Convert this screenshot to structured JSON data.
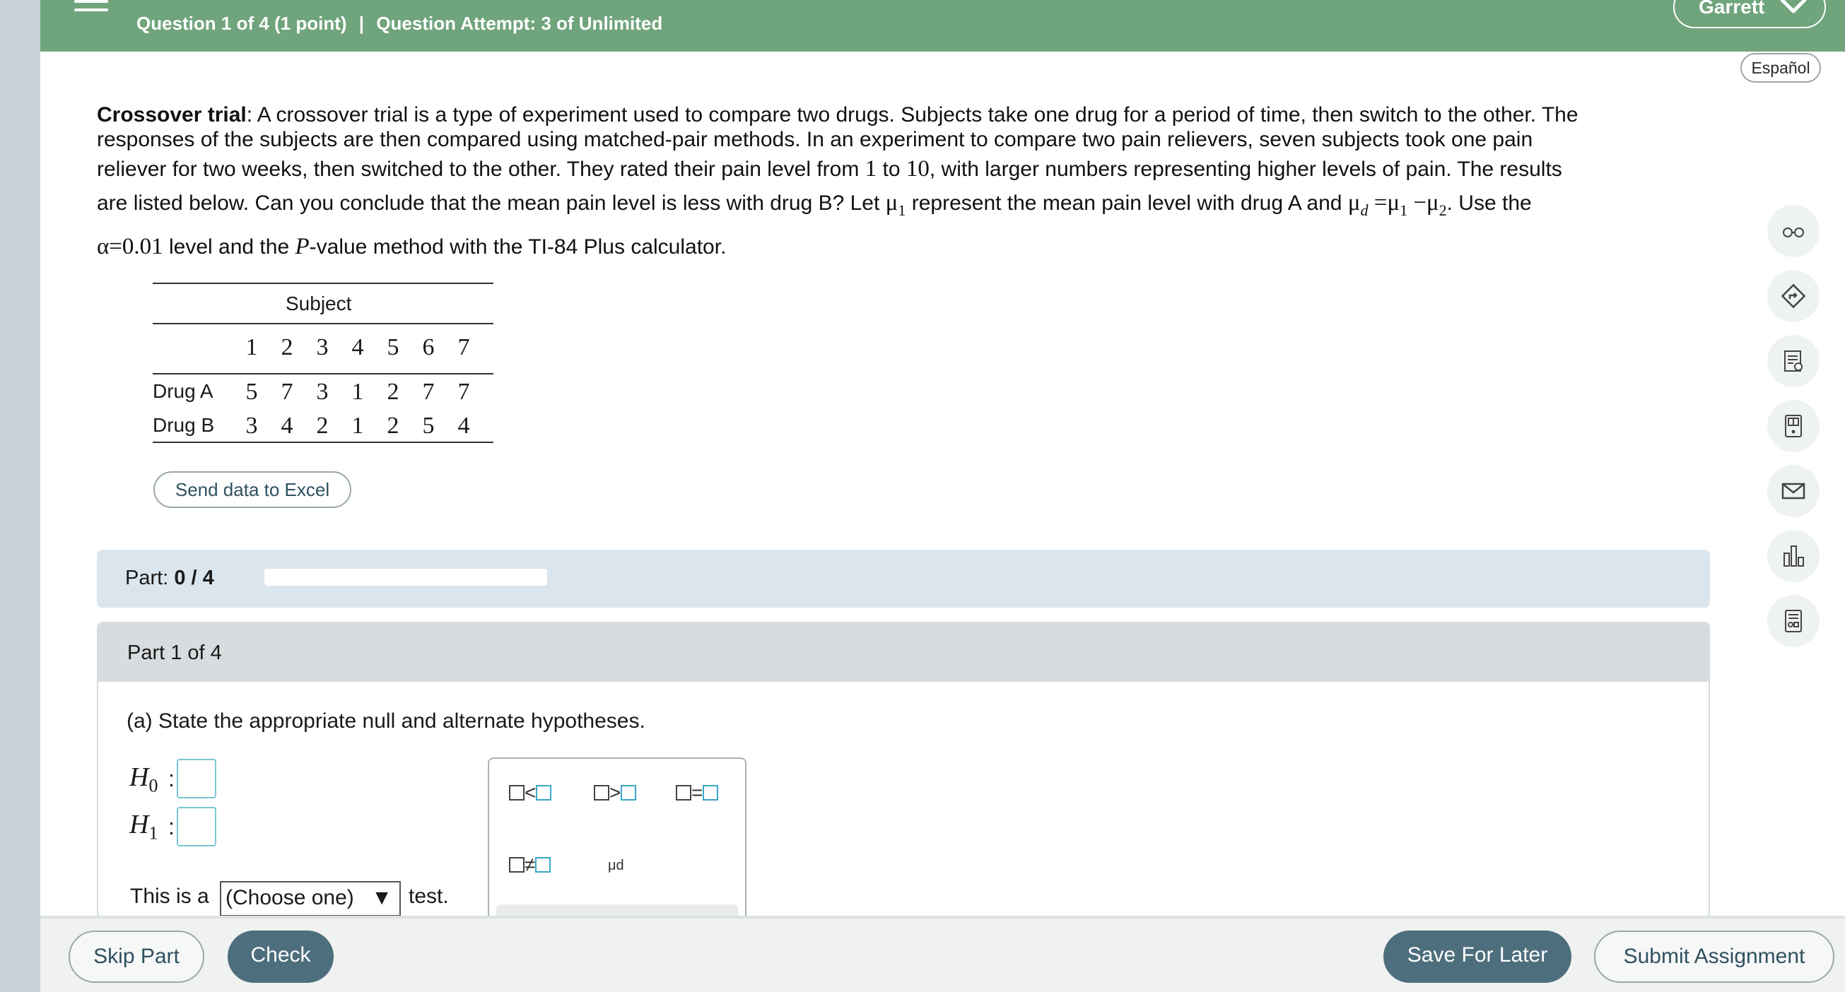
{
  "header": {
    "question_info": "Question 1 of 4 (1 point)",
    "separator": "|",
    "attempt_info": "Question Attempt: 3 of Unlimited",
    "user_name": "Garrett"
  },
  "language_button": "Español",
  "question": {
    "title": "Crossover trial",
    "line1_rest": ": A crossover trial is a type of experiment used to compare two drugs. Subjects take one drug for a period of time, then switch to the other. The",
    "line2": "responses of the subjects are then compared using matched-pair methods. In an experiment to compare two pain relievers, seven subjects took one pain",
    "line3_a": "reliever for two weeks, then switched to the other. They rated their pain level from",
    "line3_n1": "1",
    "line3_to": "to",
    "line3_n2": "10",
    "line3_b": ", with larger numbers representing higher levels of pain. The results",
    "line4_a": "are listed below. Can you conclude that the mean pain level is less with drug B? Let",
    "line4_b": "represent the mean pain level with drug A and",
    "line4_c": ". Use the",
    "alpha_expr": "α=0.01",
    "line5_a": "level and the",
    "p_letter": "P",
    "line5_b": "-value method with the TI-84 Plus calculator."
  },
  "table": {
    "header": "Subject",
    "subjects": [
      "1",
      "2",
      "3",
      "4",
      "5",
      "6",
      "7"
    ],
    "rows": [
      {
        "label": "Drug A",
        "values": [
          "5",
          "7",
          "3",
          "1",
          "2",
          "7",
          "7"
        ]
      },
      {
        "label": "Drug B",
        "values": [
          "3",
          "4",
          "2",
          "1",
          "2",
          "5",
          "4"
        ]
      }
    ]
  },
  "excel_button": "Send data to Excel",
  "part_progress": {
    "label": "Part:",
    "value": "0 / 4",
    "fraction": 0
  },
  "part_card": {
    "title": "Part 1 of 4",
    "prompt": "(a) State the appropriate null and alternate hypotheses.",
    "h0_label": "H",
    "h0_sub": "0",
    "h1_label": "H",
    "h1_sub": "1",
    "test_prefix": "This is a",
    "test_select": "(Choose one)",
    "test_suffix": "test."
  },
  "palette": {
    "less": "<",
    "greater": ">",
    "equal": "=",
    "not_equal": "≠",
    "mu_d": "μd"
  },
  "rail_icons": [
    "glasses-icon",
    "compass-icon",
    "ebook-icon",
    "calculator-icon",
    "mail-icon",
    "chart-icon",
    "worksheet-icon"
  ],
  "footer": {
    "skip": "Skip Part",
    "check": "Check",
    "save": "Save For Later",
    "submit": "Submit Assignment"
  },
  "colors": {
    "header": "#70a47c",
    "footer_button": "#4d6e7c",
    "part_bar": "#dbe5ee"
  }
}
